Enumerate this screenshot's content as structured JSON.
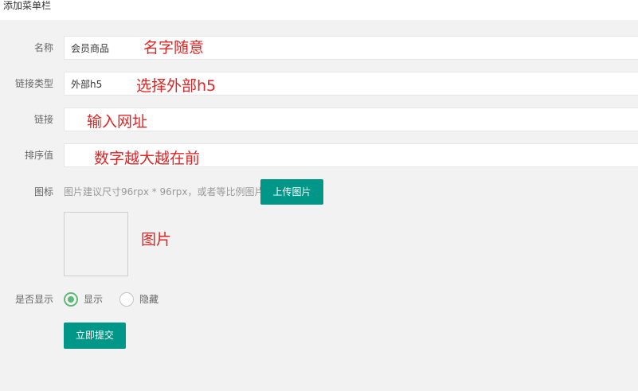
{
  "header": {
    "title": "添加菜单栏"
  },
  "form": {
    "name": {
      "label": "名称",
      "value": "会员商品",
      "note": "名字随意"
    },
    "link_type": {
      "label": "链接类型",
      "value": "外部h5",
      "note": "选择外部h5"
    },
    "link": {
      "label": "链接",
      "value": "",
      "note": "输入网址"
    },
    "sort": {
      "label": "排序值",
      "value": "",
      "note": "数字越大越在前"
    },
    "icon": {
      "label": "图标",
      "hint": "图片建议尺寸96rpx * 96rpx，或者等比例图片",
      "upload_label": "上传图片",
      "preview_note": "图片"
    },
    "visible": {
      "label": "是否显示",
      "options": [
        "显示",
        "隐藏"
      ],
      "selected": "显示"
    },
    "submit_label": "立即提交"
  },
  "colors": {
    "primary": "#009688",
    "radio_checked": "#5fb878",
    "annotation": "#e02424",
    "background": "#f2f2f2"
  }
}
